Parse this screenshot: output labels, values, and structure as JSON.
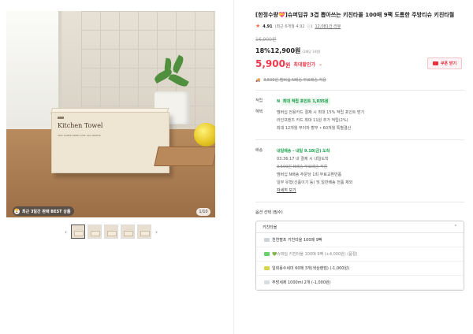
{
  "product": {
    "title": "[한정수량💝]슈퍼딥큐 3겹 뽑아쓰는 키친타올 100매 9팩 도톰한 주방티슈 키친타월",
    "rating": "4.91",
    "review_count": "(최근 6개월 4.92",
    "review_link": "12,081건 리뷰",
    "original_price": "16,900원",
    "discount_price": "18%12,900원",
    "price_unit_note": "(1매당 14원)",
    "final_price": "5,900",
    "final_price_unit": "원",
    "max_discount_label": "최대할인가",
    "coupon_label": "쿠폰 받기",
    "shipping_note": "3,500원 멤버십 N배송 무료배송 적용"
  },
  "hero": {
    "box_title": "Kitchen Towel",
    "box_subtitle": "3PLY SUPER DEEP CUTE 100 SHEETS",
    "best_badge": "최근 3일간 판매 BEST 상품",
    "counter": "1/10"
  },
  "benefits": {
    "label": "적립",
    "point": "최대 적립 포인트 1,035원",
    "card_label": "혜택",
    "lines": [
      "멤버십 전용카드 결제 시 최대 15% 적립 포인트 받기",
      "라인프렌즈 카드 최대 11원 추가 적립(2%)",
      "최대 12개월 무이자 할부 • 60개월 특별결산"
    ]
  },
  "delivery": {
    "label": "배송",
    "today": "내일배송 - 내일 9.18(금) 도착",
    "time": "03:36:17 내 결제 시 내일도착",
    "free": "3,500원 N배송 무료배송 적용",
    "return_note": "멤버십 N배송 주문당 1회 무료교환반품",
    "exclusion": "일부 유형(신품이기 등) 및 일반배송 전품 제외",
    "detail_link": "자세히 보기"
  },
  "option": {
    "title": "옵션 선택 (필수)",
    "selected": "키친타올",
    "items": [
      "천연펄프 키친타올 100매 9팩",
      "💚슈퍼딥 키친타올 100매 9팩 (+4,000원) (품절)",
      "일회용수세미 60매 3개(색상랜덤) (-1,000원)",
      "주방세제 1000ml 2개 (-1,000원)"
    ]
  }
}
